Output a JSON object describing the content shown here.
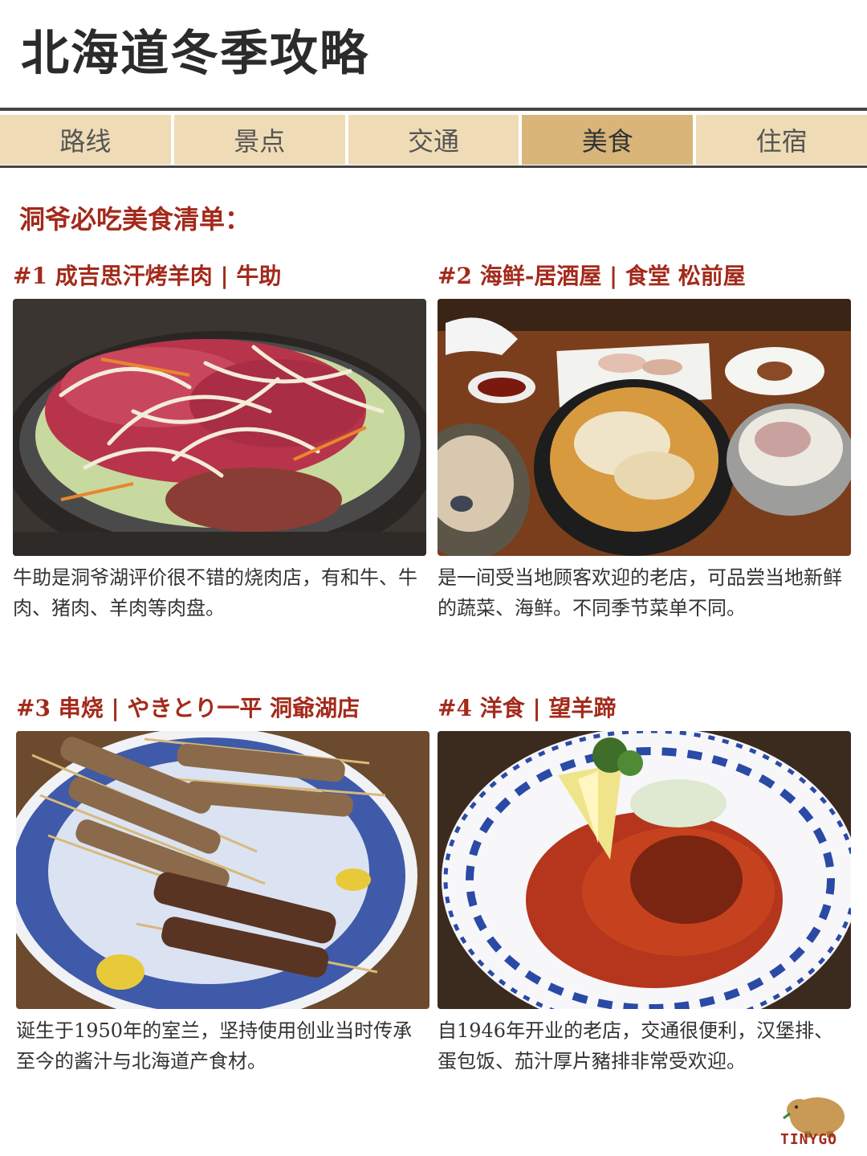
{
  "title": "北海道冬季攻略",
  "tabs": [
    {
      "label": "路线",
      "active": false
    },
    {
      "label": "景点",
      "active": false
    },
    {
      "label": "交通",
      "active": false
    },
    {
      "label": "美食",
      "active": true
    },
    {
      "label": "住宿",
      "active": false
    }
  ],
  "section_heading": "洞爷必吃美食清单：",
  "cards": [
    {
      "title": "#1 成吉思汗烤羊肉 | 牛助",
      "photo_icon": "lamb-bbq-photo",
      "desc": "牛助是洞爷湖评价很不错的烧肉店，有和牛、牛肉、猪肉、羊肉等肉盘。"
    },
    {
      "title": "#2 海鲜-居酒屋 | 食堂 松前屋",
      "photo_icon": "seafood-set-photo",
      "desc": "是一间受当地顾客欢迎的老店，可品尝当地新鲜的蔬菜、海鲜。不同季节菜单不同。"
    },
    {
      "title": "#3 串烧 | やきとり一平 洞爺湖店",
      "photo_icon": "yakitori-photo",
      "desc": "诞生于1950年的室兰，坚持使用创业当时传承至今的酱汁与北海道产食材。"
    },
    {
      "title": "#4 洋食 | 望羊蹄",
      "photo_icon": "hamburg-steak-photo",
      "desc": "自1946年开业的老店，交通很便利，汉堡排、蛋包饭、茄汁厚片豬排非常受欢迎。"
    }
  ],
  "logo": {
    "text": "TINYGO",
    "icon": "capybara-logo-icon"
  },
  "colors": {
    "accent_red": "#a32a1b",
    "tab_bg": "#efdcb6",
    "tab_active_bg": "#d9b57a"
  }
}
